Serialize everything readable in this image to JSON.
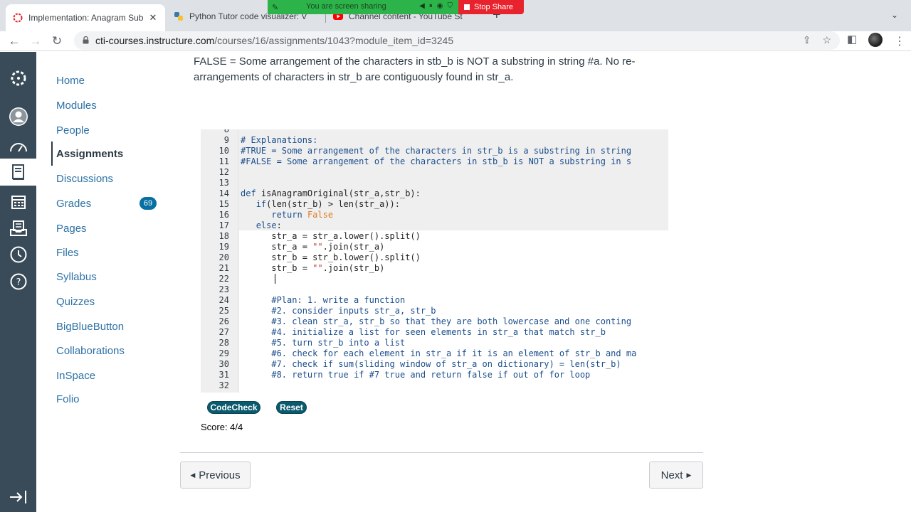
{
  "browser": {
    "tabs": [
      {
        "title": "Implementation: Anagram Sub",
        "active": true
      },
      {
        "title": "Python Tutor code visualizer: V",
        "active": false
      },
      {
        "title": "Channel content - YouTube St",
        "active": false
      }
    ],
    "url_domain": "cti-courses.instructure.com",
    "url_path": "/courses/16/assignments/1043?module_item_id=3245",
    "screen_share": {
      "status_text": "You are screen sharing",
      "stop_label": "Stop Share"
    },
    "colors": {
      "share_green": "#2cb34a",
      "share_red": "#e8232d"
    }
  },
  "global_nav": {
    "items": [
      "logo-icon",
      "account-icon",
      "dashboard-icon",
      "courses-icon",
      "calendar-icon",
      "inbox-icon",
      "history-icon",
      "help-icon"
    ],
    "active_item": "courses-icon",
    "color": "#394b58"
  },
  "course_nav": {
    "items": [
      {
        "label": "Home"
      },
      {
        "label": "Modules"
      },
      {
        "label": "People"
      },
      {
        "label": "Assignments"
      },
      {
        "label": "Discussions"
      },
      {
        "label": "Grades",
        "badge": "69"
      },
      {
        "label": "Pages"
      },
      {
        "label": "Files"
      },
      {
        "label": "Syllabus"
      },
      {
        "label": "Quizzes"
      },
      {
        "label": "BigBlueButton"
      },
      {
        "label": "Collaborations"
      },
      {
        "label": "InSpace"
      },
      {
        "label": "Folio"
      }
    ],
    "active": "Assignments"
  },
  "content": {
    "intro_text": "FALSE = Some arrangement of the characters in stb_b is NOT a substring in string #a. No re-arrangements of characters in str_b are contiguously found in str_a.",
    "code": {
      "first_partial_line_number": "8",
      "lines": [
        {
          "n": "9",
          "text": "# Explanations:",
          "type": "comment"
        },
        {
          "n": "10",
          "text": "#TRUE = Some arrangement of the characters in str_b is a substring in string",
          "type": "comment"
        },
        {
          "n": "11",
          "text": "#FALSE = Some arrangement of the characters in stb_b is NOT a substring in s",
          "type": "comment"
        },
        {
          "n": "12",
          "text": "",
          "type": "plain"
        },
        {
          "n": "13",
          "text": "",
          "type": "plain"
        },
        {
          "n": "14",
          "text": "def isAnagramOriginal(str_a,str_b):",
          "type": "def"
        },
        {
          "n": "15",
          "text": "   if(len(str_b) > len(str_a)):",
          "type": "if"
        },
        {
          "n": "16",
          "text": "      return False",
          "type": "return"
        },
        {
          "n": "17",
          "text": "   else:",
          "type": "else"
        },
        {
          "n": "18",
          "text": "      str_a = str_a.lower().split()",
          "type": "plain"
        },
        {
          "n": "19",
          "text": "      str_a = \"\".join(str_a)",
          "type": "plain"
        },
        {
          "n": "20",
          "text": "      str_b = str_b.lower().split()",
          "type": "plain"
        },
        {
          "n": "21",
          "text": "      str_b = \"\".join(str_b)",
          "type": "plain"
        },
        {
          "n": "22",
          "text": "",
          "type": "plain"
        },
        {
          "n": "23",
          "text": "",
          "type": "plain"
        },
        {
          "n": "24",
          "text": "      #Plan: 1. write a function",
          "type": "comment"
        },
        {
          "n": "25",
          "text": "      #2. consider inputs str_a, str_b",
          "type": "comment"
        },
        {
          "n": "26",
          "text": "      #3. clean str_a, str_b so that they are both lowercase and one conting",
          "type": "comment"
        },
        {
          "n": "27",
          "text": "      #4. initialize a list for seen elements in str_a that match str_b",
          "type": "comment"
        },
        {
          "n": "28",
          "text": "      #5. turn str_b into a list",
          "type": "comment"
        },
        {
          "n": "29",
          "text": "      #6. check for each element in str_a if it is an element of str_b and ma",
          "type": "comment"
        },
        {
          "n": "30",
          "text": "      #7. check if sum(sliding window of str_a on dictionary) = len(str_b)",
          "type": "comment"
        },
        {
          "n": "31",
          "text": "      #8. return true if #7 true and return false if out of for loop",
          "type": "comment"
        },
        {
          "n": "32",
          "text": "",
          "type": "plain"
        }
      ]
    },
    "buttons": {
      "codecheck": "CodeCheck",
      "reset": "Reset"
    },
    "score": "Score: 4/4",
    "pager": {
      "previous": "Previous",
      "next": "Next"
    }
  }
}
